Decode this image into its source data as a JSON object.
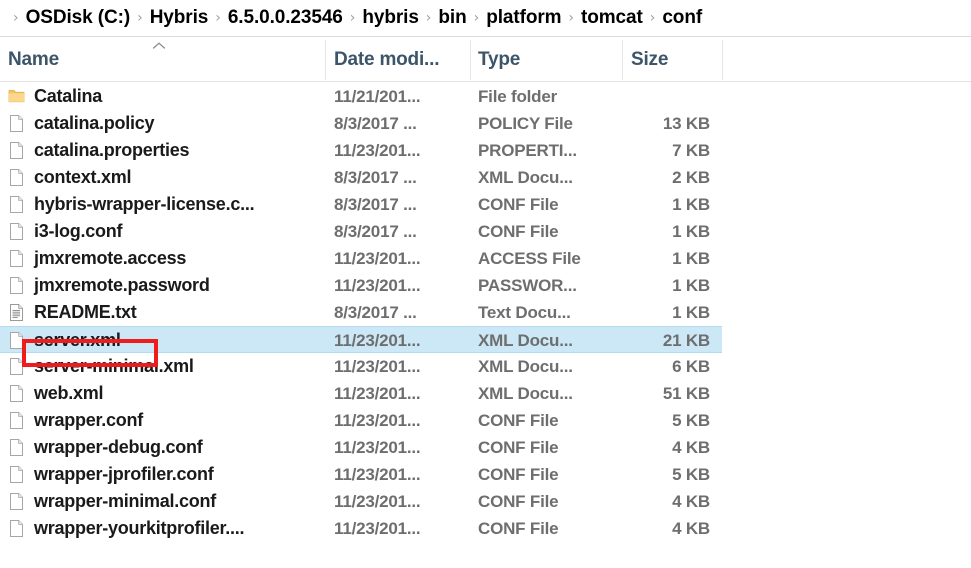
{
  "breadcrumb": {
    "separator": "›",
    "leading_separator": true,
    "items": [
      {
        "label": "OSDisk (C:)"
      },
      {
        "label": "Hybris"
      },
      {
        "label": "6.5.0.0.23546"
      },
      {
        "label": "hybris"
      },
      {
        "label": "bin"
      },
      {
        "label": "platform"
      },
      {
        "label": "tomcat"
      },
      {
        "label": "conf"
      }
    ]
  },
  "columns": {
    "name": "Name",
    "date_modified": "Date modi...",
    "type": "Type",
    "size": "Size",
    "sort_indicator": "^",
    "sort_column": "Name",
    "sort_direction": "ascending"
  },
  "colors": {
    "selection_fill": "#cce8f7",
    "selection_border": "#b4dcf0",
    "annotation": "#ee1c1c",
    "header_text": "#3d5568",
    "meta_text": "#6e6e6e",
    "name_text": "#1a1a1a",
    "folder_icon": "#f5c462",
    "divider": "#e6e6e6"
  },
  "annotation": {
    "shape": "rectangle",
    "target": "server.xml",
    "color": "#ee1c1c"
  },
  "files": [
    {
      "name": "Catalina",
      "date": "11/21/201...",
      "type": "File folder",
      "size": "",
      "icon": "folder-icon",
      "selected": false
    },
    {
      "name": "catalina.policy",
      "date": "8/3/2017 ...",
      "type": "POLICY File",
      "size": "13 KB",
      "icon": "file-icon",
      "selected": false
    },
    {
      "name": "catalina.properties",
      "date": "11/23/201...",
      "type": "PROPERTI...",
      "size": "7 KB",
      "icon": "file-icon",
      "selected": false
    },
    {
      "name": "context.xml",
      "date": "8/3/2017 ...",
      "type": "XML Docu...",
      "size": "2 KB",
      "icon": "file-icon",
      "selected": false
    },
    {
      "name": "hybris-wrapper-license.c...",
      "date": "8/3/2017 ...",
      "type": "CONF File",
      "size": "1 KB",
      "icon": "file-icon",
      "selected": false
    },
    {
      "name": "i3-log.conf",
      "date": "8/3/2017 ...",
      "type": "CONF File",
      "size": "1 KB",
      "icon": "file-icon",
      "selected": false
    },
    {
      "name": "jmxremote.access",
      "date": "11/23/201...",
      "type": "ACCESS File",
      "size": "1 KB",
      "icon": "file-icon",
      "selected": false
    },
    {
      "name": "jmxremote.password",
      "date": "11/23/201...",
      "type": "PASSWOR...",
      "size": "1 KB",
      "icon": "file-icon",
      "selected": false
    },
    {
      "name": "README.txt",
      "date": "8/3/2017 ...",
      "type": "Text Docu...",
      "size": "1 KB",
      "icon": "text-document-icon",
      "selected": false
    },
    {
      "name": "server.xml",
      "date": "11/23/201...",
      "type": "XML Docu...",
      "size": "21 KB",
      "icon": "file-icon",
      "selected": true
    },
    {
      "name": "server-minimal.xml",
      "date": "11/23/201...",
      "type": "XML Docu...",
      "size": "6 KB",
      "icon": "file-icon",
      "selected": false
    },
    {
      "name": "web.xml",
      "date": "11/23/201...",
      "type": "XML Docu...",
      "size": "51 KB",
      "icon": "file-icon",
      "selected": false
    },
    {
      "name": "wrapper.conf",
      "date": "11/23/201...",
      "type": "CONF File",
      "size": "5 KB",
      "icon": "file-icon",
      "selected": false
    },
    {
      "name": "wrapper-debug.conf",
      "date": "11/23/201...",
      "type": "CONF File",
      "size": "4 KB",
      "icon": "file-icon",
      "selected": false
    },
    {
      "name": "wrapper-jprofiler.conf",
      "date": "11/23/201...",
      "type": "CONF File",
      "size": "5 KB",
      "icon": "file-icon",
      "selected": false
    },
    {
      "name": "wrapper-minimal.conf",
      "date": "11/23/201...",
      "type": "CONF File",
      "size": "4 KB",
      "icon": "file-icon",
      "selected": false
    },
    {
      "name": "wrapper-yourkitprofiler....",
      "date": "11/23/201...",
      "type": "CONF File",
      "size": "4 KB",
      "icon": "file-icon",
      "selected": false
    }
  ]
}
